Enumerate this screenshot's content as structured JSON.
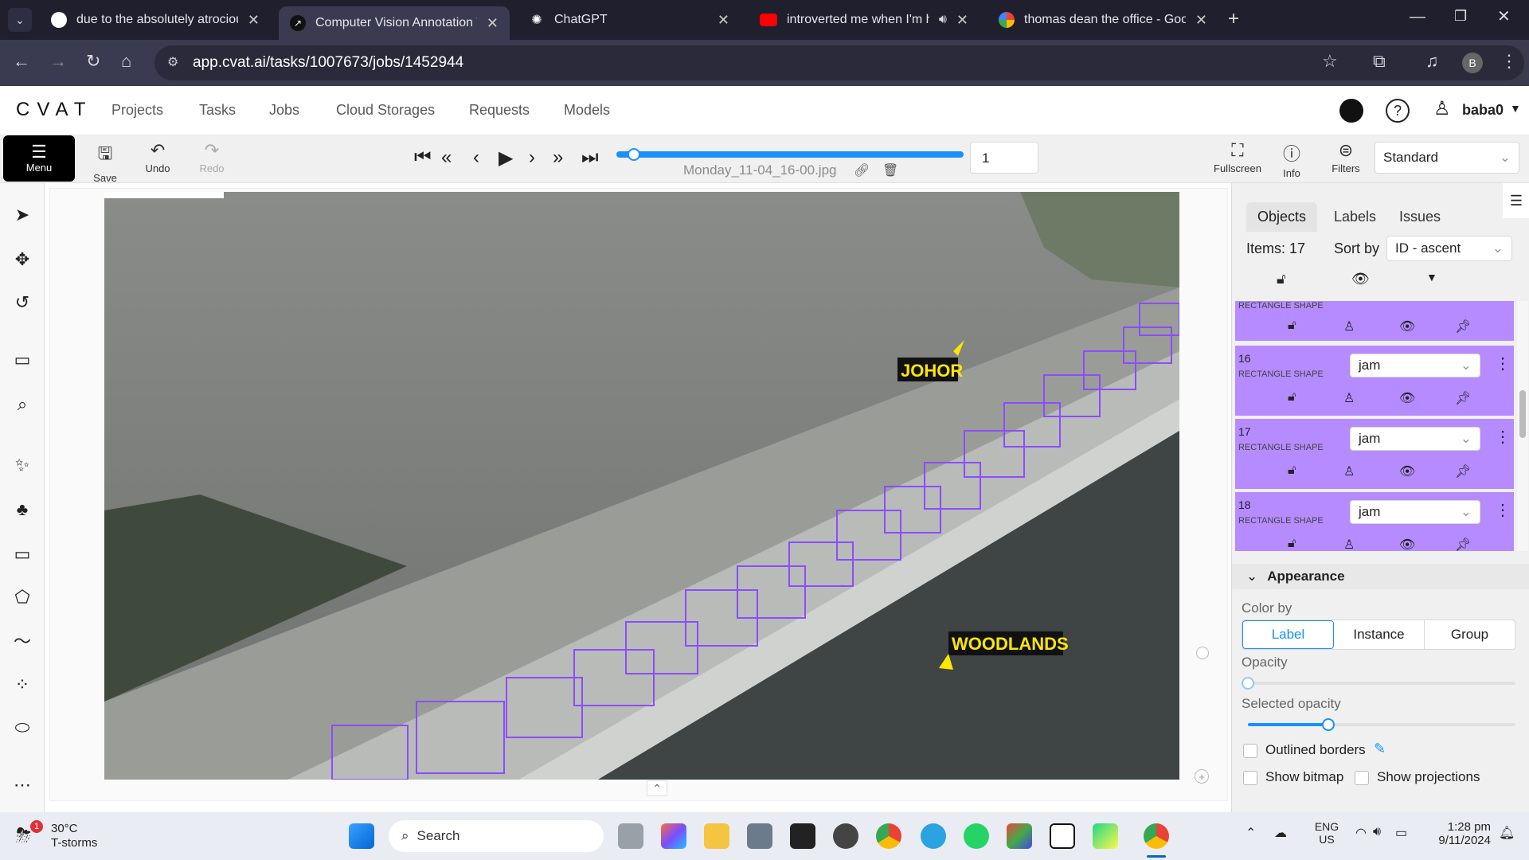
{
  "browser": {
    "tabs": [
      {
        "title": "due to the absolutely atrocious",
        "icon": "github-icon"
      },
      {
        "title": "Computer Vision Annotation To",
        "icon": "cvat-icon",
        "active": true
      },
      {
        "title": "ChatGPT",
        "icon": "chatgpt-icon"
      },
      {
        "title": "introverted me when I'm ho",
        "icon": "youtube-icon"
      },
      {
        "title": "thomas dean the office - Googl",
        "icon": "google-icon"
      }
    ],
    "url": "app.cvat.ai/tasks/1007673/jobs/1452944",
    "profile_initial": "B"
  },
  "header": {
    "logo": "CVAT",
    "nav": [
      "Projects",
      "Tasks",
      "Jobs",
      "Cloud Storages",
      "Requests",
      "Models"
    ],
    "username": "baba0"
  },
  "toolbar": {
    "menu_label": "Menu",
    "save_label": "Save",
    "undo_label": "Undo",
    "redo_label": "Redo",
    "frame_number": "1",
    "filename": "Monday_11-04_16-00.jpg",
    "fullscreen_label": "Fullscreen",
    "info_label": "Info",
    "filters_label": "Filters",
    "workspace": "Standard",
    "progress": 0.05
  },
  "image_labels": {
    "johor": "JOHOR",
    "woodlands": "WOODLANDS"
  },
  "sidebar": {
    "tabs": [
      "Objects",
      "Labels",
      "Issues"
    ],
    "items_count": "Items: 17",
    "sort_label": "Sort by",
    "sort_value": "ID - ascent",
    "objects": [
      {
        "id": "16",
        "type": "RECTANGLE SHAPE",
        "label": "jam"
      },
      {
        "id": "17",
        "type": "RECTANGLE SHAPE",
        "label": "jam"
      },
      {
        "id": "18",
        "type": "RECTANGLE SHAPE",
        "label": "jam"
      }
    ],
    "partial_type": "RECTANGLE SHAPE",
    "appearance": {
      "title": "Appearance",
      "color_by": "Color by",
      "color_options": [
        "Label",
        "Instance",
        "Group"
      ],
      "opacity_label": "Opacity",
      "opacity": 0.0,
      "selected_opacity_label": "Selected opacity",
      "selected_opacity": 0.3,
      "outlined": "Outlined borders",
      "show_bitmap": "Show bitmap",
      "show_projections": "Show projections"
    }
  },
  "taskbar": {
    "weather_temp": "30°C",
    "weather_desc": "T-storms",
    "weather_badge": "1",
    "search": "Search",
    "lang": "ENG",
    "region": "US",
    "time": "1:28 pm",
    "date": "9/11/2024"
  },
  "colors": {
    "accent": "#1890ff",
    "object_card": "#b58bff",
    "box_stroke": "#8a4dff"
  }
}
